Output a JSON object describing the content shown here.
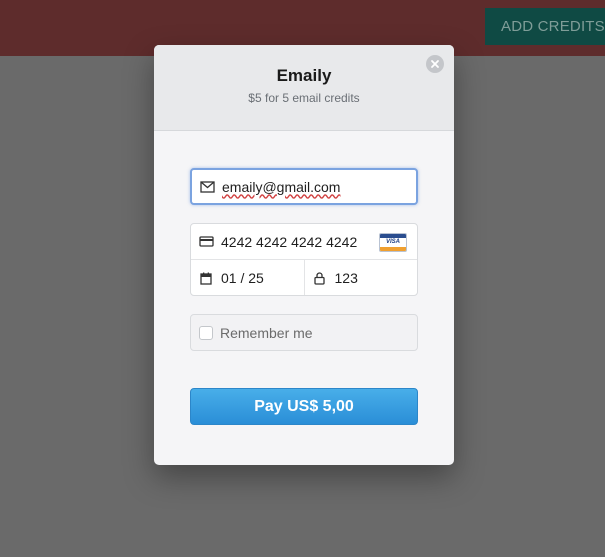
{
  "topbar": {
    "add_credits_label": "ADD CREDITS"
  },
  "modal": {
    "title": "Emaily",
    "subtitle": "$5 for 5 email credits",
    "email_value": "emaily@gmail.com",
    "card_number": "4242 4242 4242 4242",
    "card_brand": "VISA",
    "expiry": "01 / 25",
    "cvc": "123",
    "remember_label": "Remember me",
    "remember_checked": false,
    "pay_label": "Pay US$ 5,00"
  },
  "icons": {
    "close": "close-icon",
    "email": "envelope-icon",
    "card": "credit-card-icon",
    "calendar": "calendar-icon",
    "lock": "lock-icon"
  },
  "colors": {
    "topbar": "#5e2c2c",
    "add_credits_bg": "#0f4a44",
    "overlay": "#6a6a6a",
    "pay_button": "#3a9fe2"
  }
}
